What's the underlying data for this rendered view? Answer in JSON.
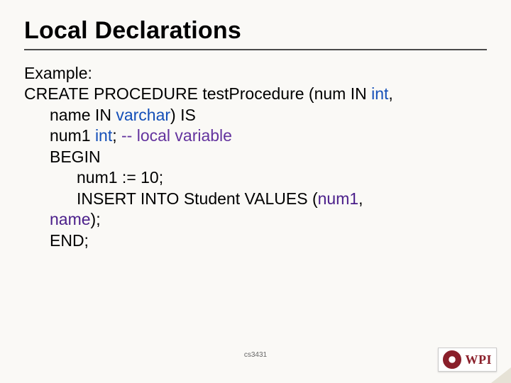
{
  "title": "Local Declarations",
  "lines": {
    "l0": "Example:",
    "l1a": "CREATE PROCEDURE testProcedure (num IN ",
    "l1b": "int",
    "l1c": ",",
    "l2a": "name IN ",
    "l2b": "varchar",
    "l2c": ") IS",
    "l3a": "num1 ",
    "l3b": "int",
    "l3c": ";   ",
    "l3d": "-- local variable",
    "l4": "BEGIN",
    "l5": "num1 := 10;",
    "l6a": "INSERT INTO Student VALUES (",
    "l6b": "num1",
    "l6c": ",",
    "l7a": "name",
    "l7b": ");",
    "l8": "END;"
  },
  "footer": "cs3431",
  "logo_text": "WPI"
}
